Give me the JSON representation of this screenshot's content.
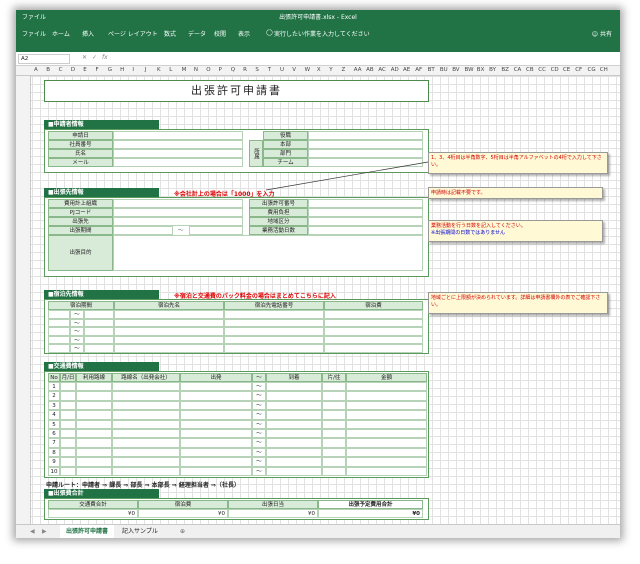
{
  "window": {
    "title": "出張許可申請書.xlsx - Excel",
    "quick_access": "ファイル"
  },
  "ribbon": {
    "tabs": [
      "ファイル",
      "ホーム",
      "挿入",
      "ページ レイアウト",
      "数式",
      "データ",
      "校閲",
      "表示"
    ],
    "search_placeholder": "実行したい作業を入力してください",
    "share_label": "共有"
  },
  "formula_bar": {
    "name_box": "A2",
    "fx": "fx"
  },
  "columns": [
    "A",
    "B",
    "C",
    "D",
    "E",
    "F",
    "G",
    "H",
    "I",
    "J",
    "K",
    "L",
    "M",
    "N",
    "O",
    "P",
    "Q",
    "R",
    "S",
    "T",
    "U",
    "V",
    "W",
    "X",
    "Y",
    "Z",
    "AA",
    "AB",
    "AC",
    "AD",
    "AE",
    "AF",
    "BT",
    "BU",
    "BV",
    "BW",
    "BX",
    "BY",
    "BZ",
    "CA",
    "CB",
    "CC",
    "CD",
    "CE",
    "CF",
    "CG",
    "CH"
  ],
  "form": {
    "title": "出張許可申請書",
    "applicant": {
      "header": "■申請者情報",
      "labels": [
        "申請日",
        "社員番号",
        "氏名",
        "メール"
      ],
      "right_labels": [
        "役職",
        "本部",
        "部門",
        "チーム"
      ],
      "affiliation": "所属"
    },
    "trip": {
      "header": "■出張先情報",
      "note": "※会社計上の場合は「1000」を入力",
      "labels": [
        "費用計上組織",
        "PJコード",
        "出張先",
        "出張期間",
        "出張目的"
      ],
      "right_labels": [
        "出張許可番号",
        "費用負担",
        "地域区分",
        "業務活動日数"
      ],
      "tilde": "～"
    },
    "lodging": {
      "header": "■宿泊先情報",
      "note": "※宿泊と交通費のパック料金の場合はまとめてこちらに記入",
      "columns": [
        "宿泊期間",
        "宿泊先名",
        "宿泊先電話番号",
        "宿泊費"
      ],
      "tilde": "～"
    },
    "transport": {
      "header": "■交通費情報",
      "columns": [
        "No",
        "月/日",
        "利用路線",
        "路線名（出発会社）",
        "出発",
        "～",
        "到着",
        "片/往",
        "金額"
      ],
      "rows": [
        "1",
        "2",
        "3",
        "4",
        "5",
        "6",
        "7",
        "8",
        "9",
        "10"
      ],
      "tilde": "～"
    },
    "route": "申請ルート：申請者 ⇒ 課長 ⇒ 部長 ⇒ 本部長 ⇒ 経理担当者 ⇒（社長）",
    "totals": {
      "header": "■出張費合計",
      "columns": [
        "交通費合計",
        "宿泊費",
        "出張日当",
        "出張予定費用合計"
      ],
      "values": [
        "¥0",
        "¥0",
        "¥0",
        "¥0"
      ]
    }
  },
  "notes": {
    "n1": "1、3、4桁目は半角数字、5桁目は半角アルファベットの4桁で入力して下さい。",
    "n2": "申請時は記載不要です。",
    "n3a": "業務活動を行う日数を記入してください。",
    "n3b": "※出張期間の日数ではありません",
    "n4": "地域ごとに上限額が決められています。詳細は申請書欄外の表でご確認下さい。"
  },
  "sheet_tabs": [
    "出張許可申請書",
    "記入サンプル"
  ],
  "add_sheet": "⊕"
}
